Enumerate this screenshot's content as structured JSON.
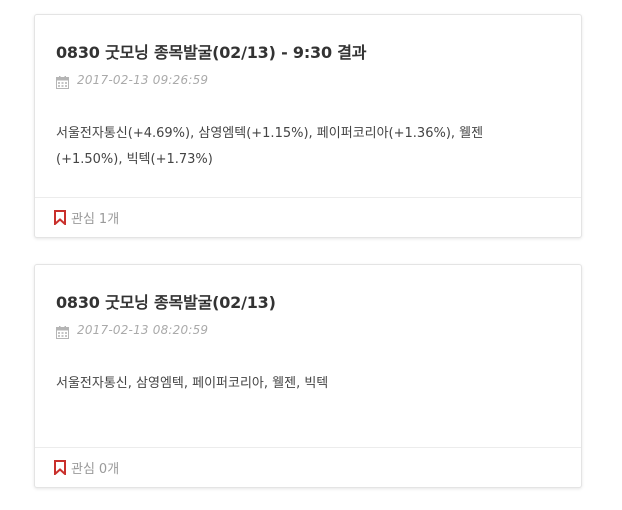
{
  "posts": [
    {
      "title": "0830 굿모닝 종목발굴(02/13) - 9:30 결과",
      "date": "2017-02-13 09:26:59",
      "body": "서울전자통신(+4.69%), 삼영엠텍(+1.15%), 페이퍼코리아(+1.36%), 웰젠(+1.50%), 빅텍(+1.73%)",
      "interest_label": "관심",
      "interest_count": "1개"
    },
    {
      "title": "0830 굿모닝 종목발굴(02/13)",
      "date": "2017-02-13 08:20:59",
      "body": "서울전자통신, 삼영엠텍, 페이퍼코리아, 웰젠, 빅텍",
      "interest_label": "관심",
      "interest_count": "0개"
    }
  ],
  "icons": {
    "calendar": "calendar-icon",
    "bookmark": "bookmark-icon"
  },
  "colors": {
    "bookmark_accent": "#c9302c",
    "title": "#333333",
    "meta": "#aaaaaa"
  }
}
